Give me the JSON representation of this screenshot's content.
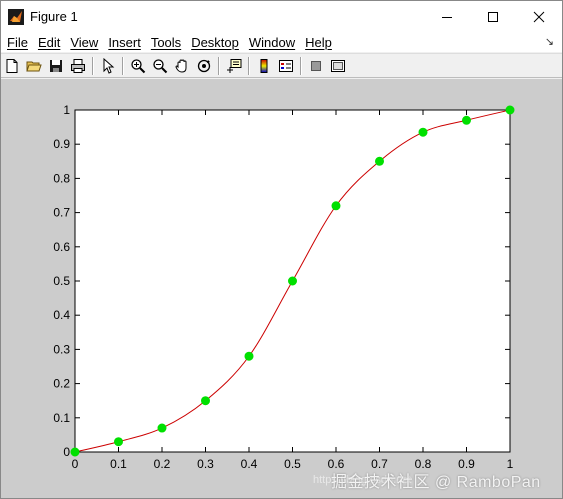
{
  "window": {
    "title": "Figure 1"
  },
  "menu": {
    "items": [
      "File",
      "Edit",
      "View",
      "Insert",
      "Tools",
      "Desktop",
      "Window",
      "Help"
    ]
  },
  "toolbar": {
    "icons": [
      "new-figure-icon",
      "open-icon",
      "save-icon",
      "print-icon",
      "pointer-icon",
      "zoom-in-icon",
      "zoom-out-icon",
      "pan-icon",
      "rotate-icon",
      "data-cursor-icon",
      "colorbar-icon",
      "legend-icon",
      "hide-plot-tools-icon",
      "show-plot-tools-icon"
    ]
  },
  "chart_data": {
    "type": "line",
    "title": "",
    "xlabel": "",
    "ylabel": "",
    "xlim": [
      0,
      1
    ],
    "ylim": [
      0,
      1
    ],
    "grid": false,
    "x_ticks": [
      "0",
      "0.1",
      "0.2",
      "0.3",
      "0.4",
      "0.5",
      "0.6",
      "0.7",
      "0.8",
      "0.9",
      "1"
    ],
    "y_ticks": [
      "0",
      "0.1",
      "0.2",
      "0.3",
      "0.4",
      "0.5",
      "0.6",
      "0.7",
      "0.8",
      "0.9",
      "1"
    ],
    "series": [
      {
        "line_color": "#cc0000",
        "marker_color": "#00e000",
        "x": [
          0,
          0.1,
          0.2,
          0.3,
          0.4,
          0.5,
          0.6,
          0.7,
          0.8,
          0.9,
          1.0
        ],
        "y": [
          0,
          0.03,
          0.07,
          0.15,
          0.28,
          0.5,
          0.72,
          0.85,
          0.935,
          0.97,
          1.0
        ]
      }
    ]
  },
  "watermark": {
    "text": "掘金技术社区 @ RamboPan",
    "faint": "https://blog.csdn.net"
  }
}
